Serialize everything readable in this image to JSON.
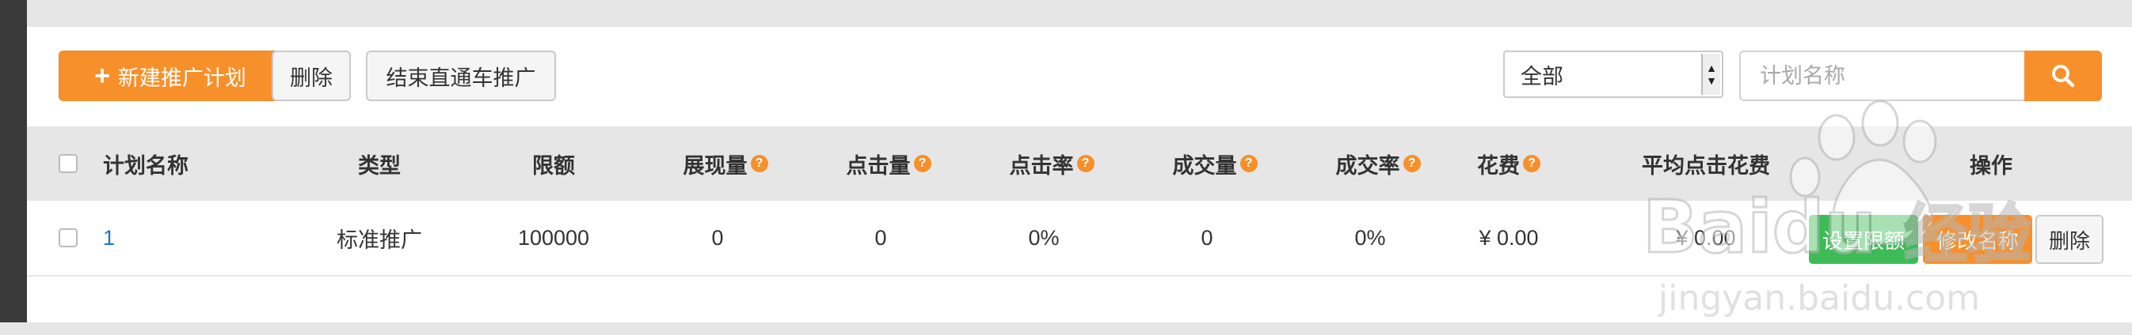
{
  "toolbar": {
    "new_plan_label": "新建推广计划",
    "delete_label": "删除",
    "end_label": "结束直通车推广",
    "filter_selected": "全部",
    "search_placeholder": "计划名称"
  },
  "table": {
    "headers": [
      "计划名称",
      "类型",
      "限额",
      "展现量",
      "点击量",
      "点击率",
      "成交量",
      "成交率",
      "花费",
      "平均点击花费",
      "操作"
    ],
    "rows": [
      {
        "name": "1",
        "type": "标准推广",
        "limit": "100000",
        "impressions": "0",
        "clicks": "0",
        "ctr": "0%",
        "deals": "0",
        "deal_rate": "0%",
        "cost": "¥ 0.00",
        "avg_click_cost": "¥ 0.00",
        "actions": [
          "设置限额",
          "修改名称",
          "删除"
        ]
      }
    ]
  },
  "watermark": {
    "brand": "Baidu",
    "brand_cn": "经验",
    "url": "jingyan.baidu.com"
  },
  "colors": {
    "accent": "#f7902a",
    "green": "#3dbb57",
    "link": "#1e74c6"
  }
}
